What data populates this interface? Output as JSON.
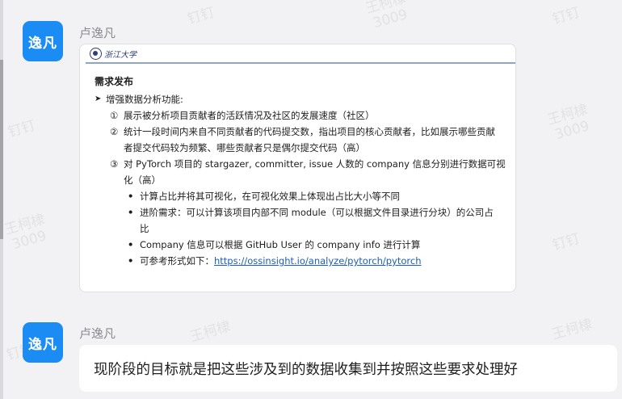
{
  "messages": [
    {
      "avatar_text": "逸凡",
      "sender": "卢逸凡",
      "document": {
        "university": "浙江大学",
        "title": "需求发布",
        "heading": "增强数据分析功能:",
        "items": [
          {
            "num": "①",
            "text": "展示被分析项目贡献者的活跃情况及社区的发展速度（社区）"
          },
          {
            "num": "②",
            "line1": "统计一段时间内来自不同贡献者的代码提交数，指出项目的核心贡献者，比如展示哪些贡献",
            "line2": "者提交代码较为频繁、哪些贡献者只是偶尔提交代码（高）"
          },
          {
            "num": "③",
            "line1": "对 PyTorch 项目的 stargazer, committer, issue 人数的 company 信息分别进行数据可视",
            "line2": "化（高）"
          }
        ],
        "sub_items": [
          {
            "text": "计算占比并将其可视化，在可视化效果上体现出占比大小等不同"
          },
          {
            "line1": "进阶需求：可以计算该项目内部不同 module（可以根据文件目录进行分块）的公司占",
            "line2": "比"
          },
          {
            "text": "Company 信息可以根据 GitHub User 的 company info 进行计算"
          },
          {
            "prefix": "可参考形式如下：",
            "link": "https://ossinsight.io/analyze/pytorch/pytorch"
          }
        ]
      }
    },
    {
      "avatar_text": "逸凡",
      "sender": "卢逸凡",
      "text": "现阶段的目标就是把这些涉及到的数据收集到并按照这些要求处理好"
    }
  ],
  "watermarks": [
    {
      "name": "王柯棣",
      "id": "3009"
    },
    {
      "name": "钉钉"
    }
  ],
  "colors": {
    "avatar_bg": "#1a8cf3",
    "link": "#1a5fb4",
    "background": "#f2f2f4"
  }
}
